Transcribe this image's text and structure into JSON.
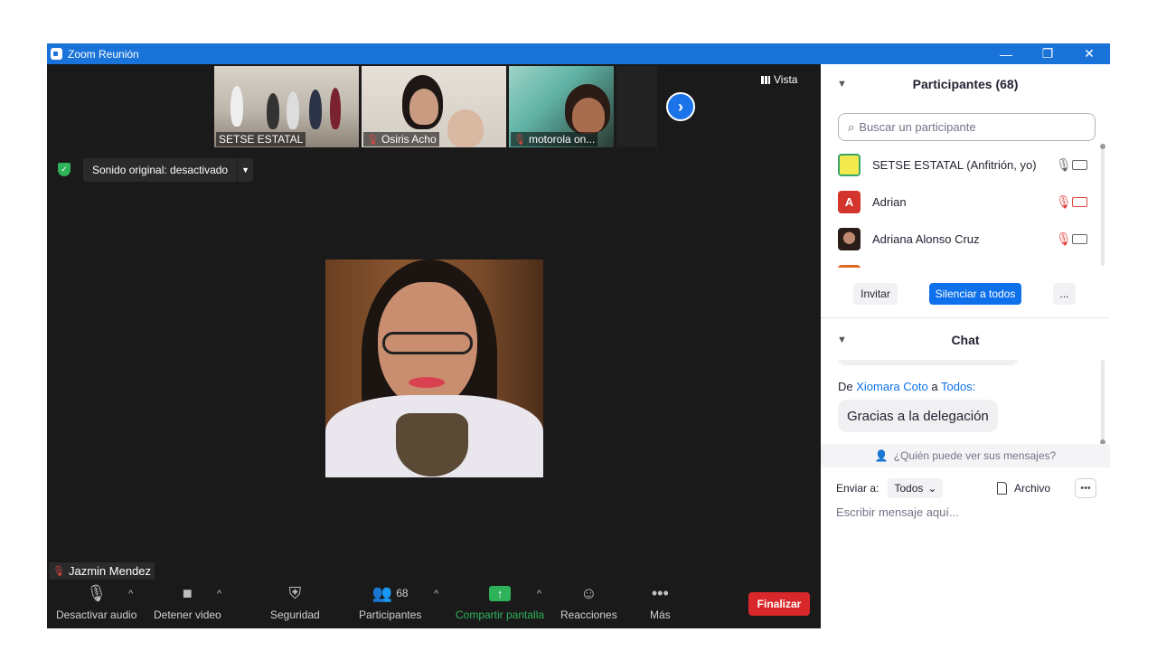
{
  "window": {
    "title": "Zoom Reunión",
    "controls": {
      "minimize": "—",
      "restore": "❐",
      "close": "✕"
    }
  },
  "video": {
    "thumbnails": [
      {
        "name": "SETSE ESTATAL",
        "muted": false
      },
      {
        "name": "Osiris Acho",
        "muted": true
      },
      {
        "name": "motorola on...",
        "muted": true
      }
    ],
    "next_page": "›",
    "view_label": "Vista",
    "original_sound": "Sonido original: desactivado",
    "active_speaker": "Jazmin Mendez"
  },
  "toolbar": {
    "mute_audio": "Desactivar audio",
    "stop_video": "Detener video",
    "security": "Seguridad",
    "participants": "Participantes",
    "participants_count": "68",
    "share_screen": "Compartir pantalla",
    "reactions": "Reacciones",
    "more": "Más",
    "end": "Finalizar"
  },
  "participants_panel": {
    "title": "Participantes (68)",
    "search_placeholder": "Buscar un participante",
    "participants": [
      {
        "name": "SETSE ESTATAL (Anfitrión, yo)",
        "avatar": "logo",
        "mic": "on",
        "video": "on"
      },
      {
        "name": "Adrian",
        "avatar": "A",
        "mic": "off",
        "video": "off"
      },
      {
        "name": "Adriana Alonso Cruz",
        "avatar": "photo",
        "mic": "off",
        "video": "on"
      }
    ],
    "invite": "Invitar",
    "mute_all": "Silenciar a todos",
    "more": "..."
  },
  "chat": {
    "title": "Chat",
    "message": {
      "from_prefix": "De",
      "sender": "Xiomara Coto",
      "to_prefix": "a",
      "recipient": "Todos:",
      "text": "Gracias a la delegación"
    },
    "who_can_see": "¿Quién puede ver sus mensajes?",
    "send_to_label": "Enviar a:",
    "send_to_value": "Todos",
    "file_label": "Archivo",
    "input_placeholder": "Escribir mensaje aquí..."
  },
  "colors": {
    "titlebar": "#1a73d9",
    "accent_blue": "#0e71eb",
    "share_green": "#2eb35a",
    "end_red": "#d9282b",
    "muted_red": "#e0443e"
  }
}
